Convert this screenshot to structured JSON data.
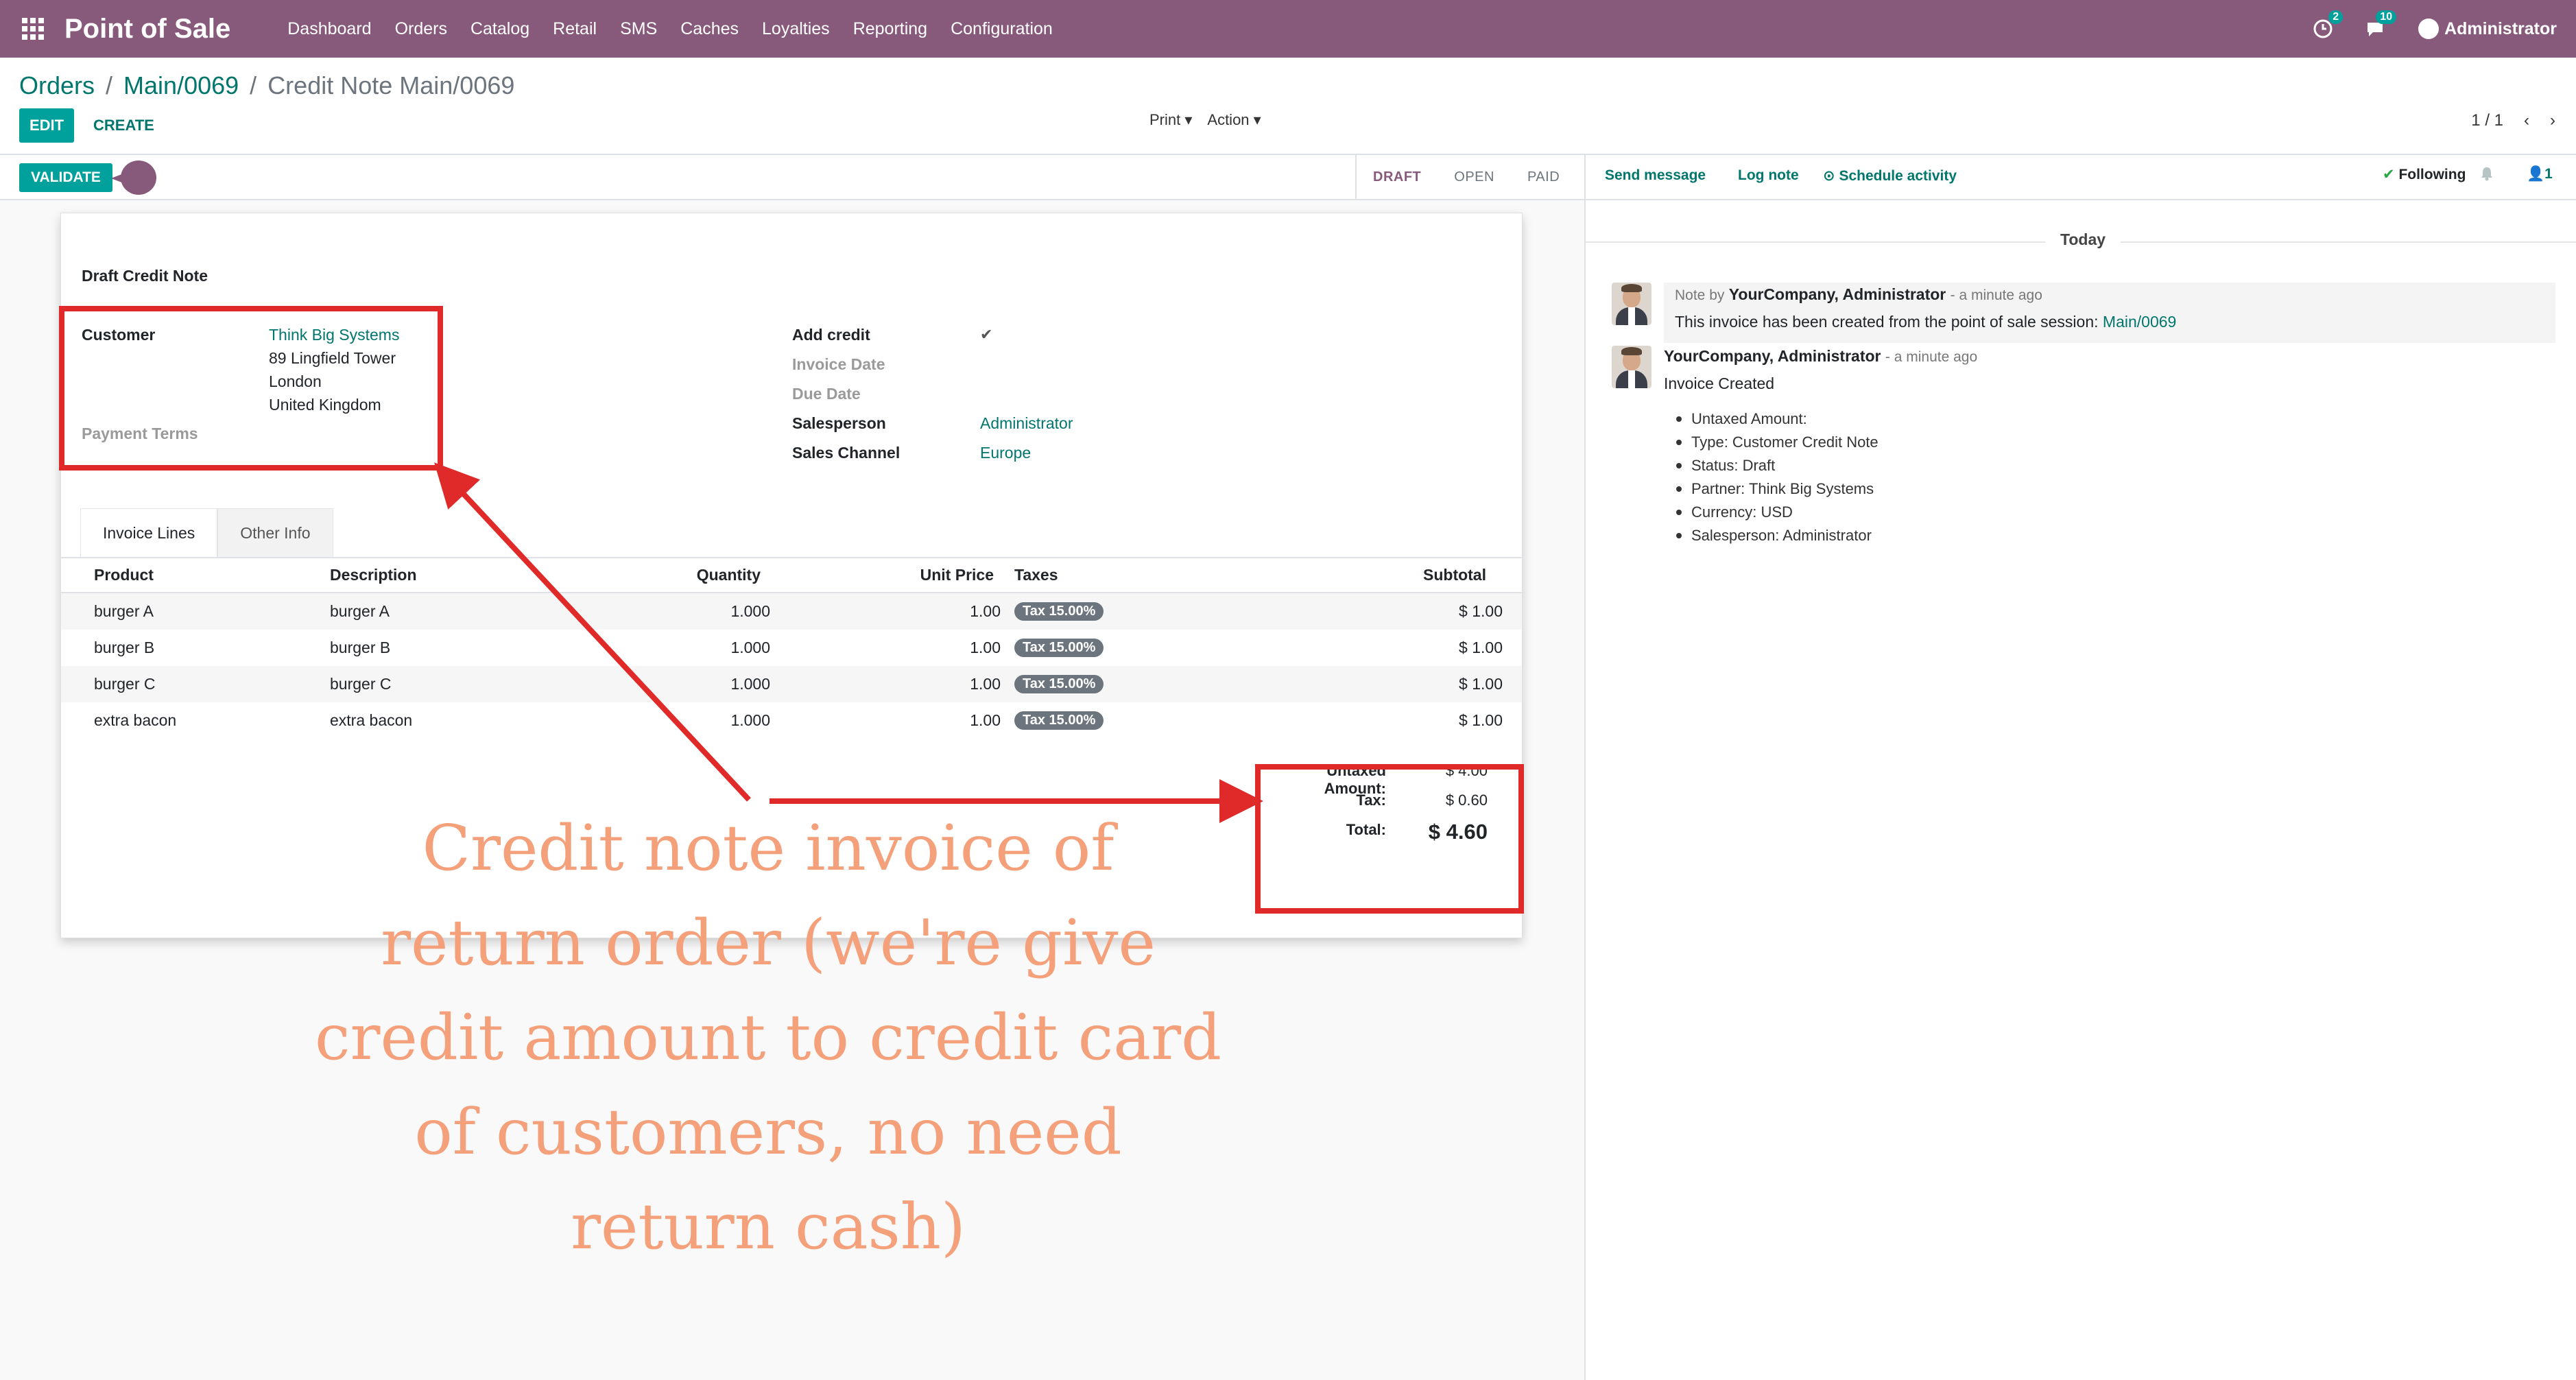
{
  "navbar": {
    "app_title": "Point of Sale",
    "menu": [
      "Dashboard",
      "Orders",
      "Catalog",
      "Retail",
      "SMS",
      "Caches",
      "Loyalties",
      "Reporting",
      "Configuration"
    ],
    "activity_count": "2",
    "messages_count": "10",
    "user": "Administrator"
  },
  "breadcrumb": {
    "items": [
      "Orders",
      "Main/0069"
    ],
    "current": "Credit Note Main/0069"
  },
  "toolbar": {
    "edit_label": "EDIT",
    "create_label": "CREATE",
    "print_label": "Print ▾",
    "action_label": "Action ▾",
    "pager": "1 / 1"
  },
  "statusbar": {
    "validate_label": "VALIDATE",
    "stages": [
      "DRAFT",
      "OPEN",
      "PAID"
    ],
    "active_stage": "DRAFT"
  },
  "form": {
    "title": "Draft Credit Note",
    "customer_label": "Customer",
    "customer_name": "Think Big Systems",
    "address": [
      "89 Lingfield Tower",
      "London",
      "United Kingdom"
    ],
    "payment_terms_label": "Payment Terms",
    "add_credit_label": "Add credit",
    "add_credit_mark": "✔",
    "invoice_date_label": "Invoice Date",
    "due_date_label": "Due Date",
    "salesperson_label": "Salesperson",
    "salesperson_value": "Administrator",
    "sales_channel_label": "Sales Channel",
    "sales_channel_value": "Europe"
  },
  "tabs": [
    "Invoice Lines",
    "Other Info"
  ],
  "table": {
    "headers": [
      "Product",
      "Description",
      "Quantity",
      "Unit Price",
      "Taxes",
      "Subtotal"
    ],
    "rows": [
      {
        "product": "burger A",
        "description": "burger A",
        "quantity": "1.000",
        "unit_price": "1.00",
        "tax": "Tax 15.00%",
        "subtotal": "$ 1.00"
      },
      {
        "product": "burger B",
        "description": "burger B",
        "quantity": "1.000",
        "unit_price": "1.00",
        "tax": "Tax 15.00%",
        "subtotal": "$ 1.00"
      },
      {
        "product": "burger C",
        "description": "burger C",
        "quantity": "1.000",
        "unit_price": "1.00",
        "tax": "Tax 15.00%",
        "subtotal": "$ 1.00"
      },
      {
        "product": "extra bacon",
        "description": "extra bacon",
        "quantity": "1.000",
        "unit_price": "1.00",
        "tax": "Tax 15.00%",
        "subtotal": "$ 1.00"
      }
    ]
  },
  "totals": {
    "untaxed_label": "Untaxed Amount:",
    "untaxed_value": "$ 4.00",
    "tax_label": "Tax:",
    "tax_value": "$ 0.60",
    "total_label": "Total:",
    "total_value": "$ 4.60"
  },
  "chatter": {
    "send_message": "Send message",
    "log_note": "Log note",
    "schedule_activity": "Schedule activity",
    "following": "Following",
    "followers_count": "1",
    "today": "Today",
    "note_prefix": "Note by",
    "note_author": "YourCompany, Administrator",
    "note_time": "- a minute ago",
    "note_body": "This invoice has been created from the point of sale session:",
    "note_link": "Main/0069",
    "msg_author": "YourCompany, Administrator",
    "msg_time": "- a minute ago",
    "msg_title": "Invoice Created",
    "msg_items": [
      "Untaxed Amount:",
      "Type: Customer Credit Note",
      "Status: Draft",
      "Partner: Think Big Systems",
      "Currency: USD",
      "Salesperson: Administrator"
    ]
  },
  "annotation": {
    "lines": [
      "Credit note invoice of",
      "return order (we're give",
      "credit amount to credit card",
      "of customers, no need",
      "return cash)"
    ],
    "color": "#f4a07a",
    "box_color": "#e02a2a"
  },
  "colors": {
    "navbar": "#875a7b",
    "primary": "#00a09d",
    "link": "#00766d"
  }
}
